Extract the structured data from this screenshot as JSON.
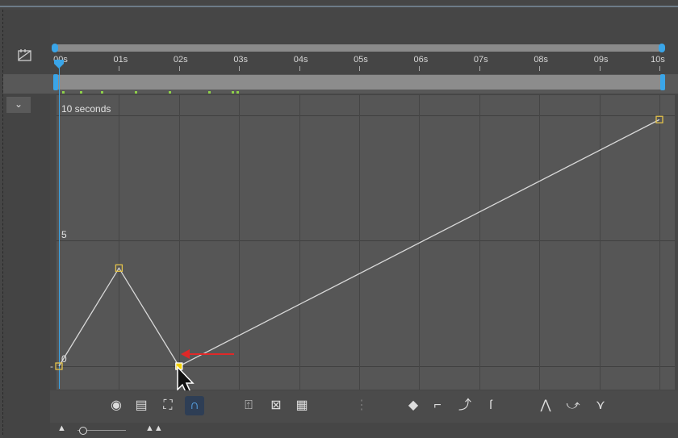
{
  "ruler": {
    "ticks": [
      "00s",
      "01s",
      "02s",
      "03s",
      "04s",
      "05s",
      "06s",
      "07s",
      "08s",
      "09s",
      "10s"
    ]
  },
  "collapse_toggle": "⌄",
  "graph": {
    "label_top": "10 seconds",
    "label_mid": "5",
    "label_bottom": "0",
    "label_minus": "-"
  },
  "keyframes": [
    {
      "time_s": 0,
      "value": 0
    },
    {
      "time_s": 1,
      "value": 3.9
    },
    {
      "time_s": 2,
      "value": 0,
      "selected": true
    },
    {
      "time_s": 10,
      "value": 9.8
    }
  ],
  "colors": {
    "playhead": "#3aa5e8",
    "keyframe": "#e3c24a",
    "selected_keyframe": "#f3d000",
    "curve": "#d8d8d8",
    "annotation_arrow": "#e02828",
    "key_marker": "#8fd04a"
  },
  "toolbar": {
    "icons": [
      "eye-icon",
      "layer-menu-icon",
      "transform-box-icon",
      "magnet-icon",
      "zoom-fit-icon",
      "graph-type-icon",
      "graph-overlay-icon",
      "separator-icon",
      "keyframe-diamond-icon",
      "convert-corner-icon",
      "ease-in-out-icon",
      "ease-out-icon",
      "auto-bezier-icon",
      "smooth-icon",
      "linear-icon"
    ]
  }
}
